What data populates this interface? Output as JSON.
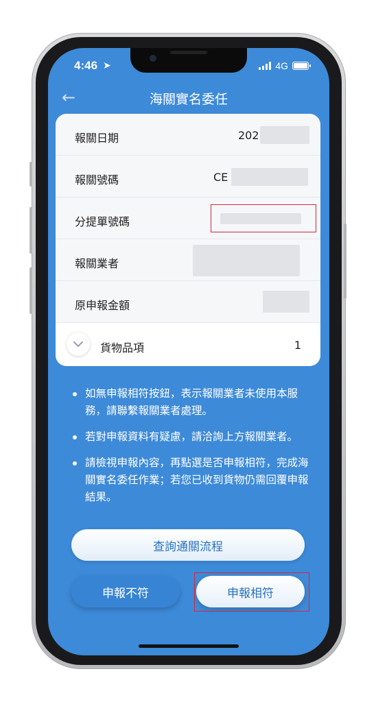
{
  "status": {
    "time": "4:46",
    "network": "4G"
  },
  "header": {
    "title": "海關實名委任",
    "back_icon": "arrow-left-icon"
  },
  "details": {
    "rows": [
      {
        "label": "報關日期",
        "value_prefix": "202"
      },
      {
        "label": "報關號碼",
        "value_prefix": "CE"
      },
      {
        "label": "分提單號碼",
        "value_prefix": ""
      },
      {
        "label": "報關業者",
        "value_prefix": ""
      },
      {
        "label": "原申報金額",
        "value_prefix": ""
      }
    ],
    "goods": {
      "label": "貨物品項",
      "count": "1"
    }
  },
  "notes": [
    "如無申報相符按鈕，表示報關業者未使用本服務，請聯繫報關業者處理。",
    "若對申報資料有疑慮，請洽詢上方報關業者。",
    "請檢視申報內容，再點選是否申報相符，完成海關實名委任作業；若您已收到貨物仍需回覆申報結果。"
  ],
  "buttons": {
    "query": "查詢通關流程",
    "mismatch": "申報不符",
    "match": "申報相符"
  },
  "colors": {
    "screen_bg": "#3d8ad8",
    "accent": "#2a72bf",
    "highlight": "#d7263d"
  }
}
